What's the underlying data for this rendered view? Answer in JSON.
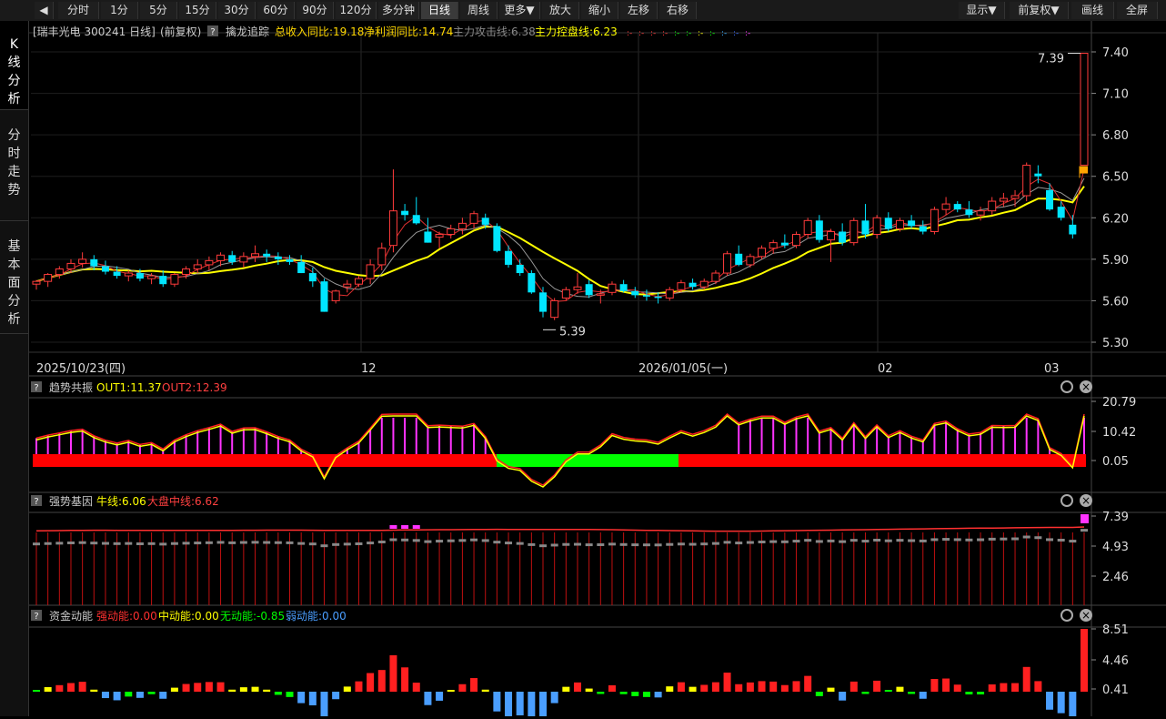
{
  "toolbar": {
    "left": [
      "分时",
      "1分",
      "5分",
      "15分",
      "30分",
      "60分",
      "90分",
      "120分",
      "多分钟",
      "日线",
      "周线",
      "更多▼",
      "放大",
      "缩小",
      "左移",
      "右移"
    ],
    "active": "日线",
    "right": [
      "显示▼",
      "前复权▼",
      "画线",
      "全屏"
    ]
  },
  "sidebar": {
    "tabs": [
      {
        "label": "K线分析",
        "active": true
      },
      {
        "label": "分时走势",
        "active": false
      },
      {
        "label": "基本面分析",
        "active": false
      }
    ]
  },
  "main_panel": {
    "stock_title": "[瑞丰光电 300241 日线]",
    "adjust": "(前复权)",
    "indicator_name": "擒龙追踪",
    "metrics": [
      {
        "text": "总收入同比:19.18",
        "color": "#ffd700"
      },
      {
        "text": "净利润同比:14.74",
        "color": "#ffd700"
      },
      {
        "text": "主力攻击线:6.38",
        "color": "#888888"
      },
      {
        "text": "主力控盘线:6.23",
        "color": "#ffff00"
      }
    ],
    "yticks": [
      "7.40",
      "7.10",
      "6.80",
      "6.50",
      "6.20",
      "5.90",
      "5.60",
      "5.30"
    ],
    "ylim": [
      5.3,
      7.4
    ],
    "xaxis": [
      "2025/10/23(四)",
      "12",
      "2026/01/05(一)",
      "02",
      "03"
    ],
    "annotations": {
      "high": "7.39",
      "low": "5.39"
    }
  },
  "sub1": {
    "name": "趋势共振",
    "out1": "OUT1:11.37",
    "out2": "OUT2:12.39",
    "yticks": [
      "20.79",
      "10.42",
      "0.05"
    ]
  },
  "sub2": {
    "name": "强势基因",
    "bull": "牛线:6.06",
    "mid": "大盘中线:6.62",
    "yticks": [
      "7.39",
      "4.93",
      "2.46"
    ]
  },
  "sub3": {
    "name": "资金动能",
    "strong": "强动能:0.00",
    "medium": "中动能:0.00",
    "none": "无动能:-0.85",
    "weak": "弱动能:0.00",
    "yticks": [
      "8.51",
      "4.46",
      "0.41"
    ]
  },
  "colors": {
    "up": "#ff3b3b",
    "down": "#00e5ff",
    "ma_yellow": "#ffff00",
    "ma_red": "#e03030",
    "ma_gray": "#999999",
    "green": "#00ff00",
    "magenta": "#ff33ff"
  },
  "chart_data": {
    "type": "candlestick",
    "ylim": [
      5.3,
      7.4
    ],
    "ohlc": [
      [
        5.72,
        5.75,
        5.68,
        5.74
      ],
      [
        5.74,
        5.8,
        5.7,
        5.79
      ],
      [
        5.79,
        5.85,
        5.76,
        5.83
      ],
      [
        5.83,
        5.9,
        5.8,
        5.87
      ],
      [
        5.87,
        5.95,
        5.84,
        5.9
      ],
      [
        5.9,
        5.93,
        5.82,
        5.85
      ],
      [
        5.85,
        5.89,
        5.79,
        5.81
      ],
      [
        5.81,
        5.85,
        5.76,
        5.78
      ],
      [
        5.78,
        5.82,
        5.74,
        5.8
      ],
      [
        5.8,
        5.83,
        5.74,
        5.76
      ],
      [
        5.76,
        5.8,
        5.72,
        5.78
      ],
      [
        5.78,
        5.82,
        5.7,
        5.72
      ],
      [
        5.72,
        5.8,
        5.7,
        5.79
      ],
      [
        5.79,
        5.85,
        5.76,
        5.83
      ],
      [
        5.83,
        5.9,
        5.8,
        5.86
      ],
      [
        5.86,
        5.92,
        5.82,
        5.89
      ],
      [
        5.89,
        5.95,
        5.85,
        5.93
      ],
      [
        5.93,
        5.96,
        5.86,
        5.88
      ],
      [
        5.88,
        5.95,
        5.84,
        5.92
      ],
      [
        5.92,
        6.0,
        5.88,
        5.94
      ],
      [
        5.94,
        5.97,
        5.88,
        5.92
      ],
      [
        5.92,
        5.95,
        5.86,
        5.9
      ],
      [
        5.9,
        5.93,
        5.86,
        5.88
      ],
      [
        5.88,
        5.93,
        5.8,
        5.8
      ],
      [
        5.8,
        5.84,
        5.7,
        5.74
      ],
      [
        5.74,
        5.76,
        5.52,
        5.52
      ],
      [
        5.6,
        5.68,
        5.58,
        5.67
      ],
      [
        5.7,
        5.75,
        5.66,
        5.72
      ],
      [
        5.72,
        5.78,
        5.7,
        5.76
      ],
      [
        5.76,
        5.9,
        5.72,
        5.86
      ],
      [
        5.86,
        6.02,
        5.82,
        5.98
      ],
      [
        6.0,
        6.55,
        5.95,
        6.25
      ],
      [
        6.25,
        6.3,
        6.18,
        6.22
      ],
      [
        6.22,
        6.35,
        6.15,
        6.16
      ],
      [
        6.1,
        6.2,
        6.02,
        6.02
      ],
      [
        6.06,
        6.1,
        5.98,
        6.08
      ],
      [
        6.08,
        6.15,
        6.05,
        6.12
      ],
      [
        6.12,
        6.2,
        6.08,
        6.16
      ],
      [
        6.16,
        6.25,
        6.12,
        6.23
      ],
      [
        6.2,
        6.23,
        6.12,
        6.15
      ],
      [
        6.14,
        6.16,
        5.95,
        5.96
      ],
      [
        5.96,
        6.0,
        5.84,
        5.86
      ],
      [
        5.86,
        5.9,
        5.78,
        5.8
      ],
      [
        5.8,
        5.82,
        5.65,
        5.66
      ],
      [
        5.66,
        5.7,
        5.48,
        5.52
      ],
      [
        5.48,
        5.62,
        5.46,
        5.6
      ],
      [
        5.62,
        5.7,
        5.6,
        5.68
      ],
      [
        5.68,
        5.8,
        5.65,
        5.7
      ],
      [
        5.72,
        5.75,
        5.62,
        5.64
      ],
      [
        5.64,
        5.68,
        5.58,
        5.65
      ],
      [
        5.66,
        5.74,
        5.64,
        5.72
      ],
      [
        5.72,
        5.75,
        5.66,
        5.67
      ],
      [
        5.67,
        5.7,
        5.62,
        5.64
      ],
      [
        5.64,
        5.68,
        5.6,
        5.63
      ],
      [
        5.63,
        5.66,
        5.58,
        5.62
      ],
      [
        5.62,
        5.7,
        5.6,
        5.68
      ],
      [
        5.68,
        5.75,
        5.66,
        5.73
      ],
      [
        5.73,
        5.76,
        5.68,
        5.7
      ],
      [
        5.7,
        5.76,
        5.68,
        5.74
      ],
      [
        5.74,
        5.82,
        5.72,
        5.8
      ],
      [
        5.8,
        5.96,
        5.78,
        5.94
      ],
      [
        5.94,
        6.0,
        5.85,
        5.86
      ],
      [
        5.86,
        5.94,
        5.84,
        5.92
      ],
      [
        5.92,
        6.0,
        5.9,
        5.98
      ],
      [
        5.98,
        6.04,
        5.94,
        6.02
      ],
      [
        6.02,
        6.08,
        5.98,
        6.0
      ],
      [
        6.0,
        6.1,
        5.98,
        6.08
      ],
      [
        6.08,
        6.2,
        6.05,
        6.18
      ],
      [
        6.18,
        6.22,
        6.02,
        6.04
      ],
      [
        6.04,
        6.12,
        5.88,
        6.1
      ],
      [
        6.1,
        6.16,
        6.0,
        6.02
      ],
      [
        6.02,
        6.2,
        6.0,
        6.18
      ],
      [
        6.18,
        6.3,
        6.05,
        6.08
      ],
      [
        6.08,
        6.22,
        6.05,
        6.2
      ],
      [
        6.2,
        6.24,
        6.1,
        6.12
      ],
      [
        6.12,
        6.2,
        6.1,
        6.18
      ],
      [
        6.18,
        6.22,
        6.12,
        6.14
      ],
      [
        6.14,
        6.18,
        6.08,
        6.1
      ],
      [
        6.1,
        6.28,
        6.08,
        6.26
      ],
      [
        6.26,
        6.35,
        6.22,
        6.3
      ],
      [
        6.3,
        6.32,
        6.24,
        6.26
      ],
      [
        6.26,
        6.32,
        6.2,
        6.22
      ],
      [
        6.22,
        6.28,
        6.18,
        6.25
      ],
      [
        6.25,
        6.35,
        6.22,
        6.32
      ],
      [
        6.32,
        6.38,
        6.28,
        6.34
      ],
      [
        6.34,
        6.4,
        6.28,
        6.36
      ],
      [
        6.36,
        6.6,
        6.32,
        6.58
      ],
      [
        6.52,
        6.58,
        6.45,
        6.5
      ],
      [
        6.4,
        6.45,
        6.25,
        6.26
      ],
      [
        6.28,
        6.32,
        6.18,
        6.2
      ],
      [
        6.15,
        6.22,
        6.05,
        6.08
      ],
      [
        6.58,
        7.39,
        6.58,
        7.39
      ]
    ]
  }
}
